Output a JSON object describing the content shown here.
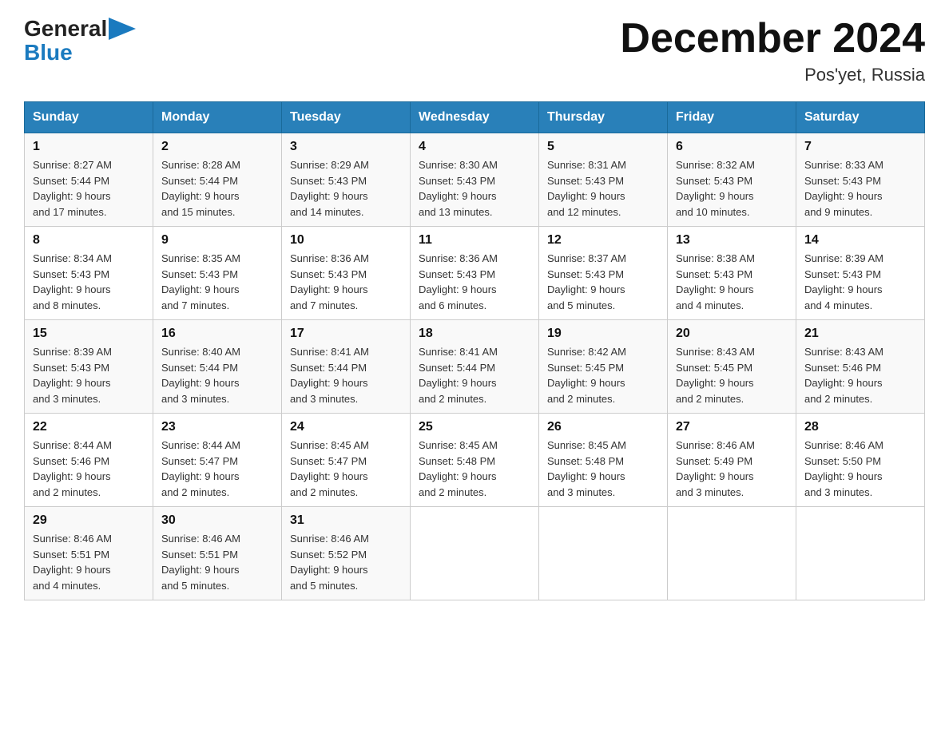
{
  "header": {
    "logo_text1": "General",
    "logo_text2": "Blue",
    "month": "December 2024",
    "location": "Pos'yet, Russia"
  },
  "days_of_week": [
    "Sunday",
    "Monday",
    "Tuesday",
    "Wednesday",
    "Thursday",
    "Friday",
    "Saturday"
  ],
  "weeks": [
    [
      {
        "day": "1",
        "sunrise": "8:27 AM",
        "sunset": "5:44 PM",
        "daylight": "9 hours and 17 minutes."
      },
      {
        "day": "2",
        "sunrise": "8:28 AM",
        "sunset": "5:44 PM",
        "daylight": "9 hours and 15 minutes."
      },
      {
        "day": "3",
        "sunrise": "8:29 AM",
        "sunset": "5:43 PM",
        "daylight": "9 hours and 14 minutes."
      },
      {
        "day": "4",
        "sunrise": "8:30 AM",
        "sunset": "5:43 PM",
        "daylight": "9 hours and 13 minutes."
      },
      {
        "day": "5",
        "sunrise": "8:31 AM",
        "sunset": "5:43 PM",
        "daylight": "9 hours and 12 minutes."
      },
      {
        "day": "6",
        "sunrise": "8:32 AM",
        "sunset": "5:43 PM",
        "daylight": "9 hours and 10 minutes."
      },
      {
        "day": "7",
        "sunrise": "8:33 AM",
        "sunset": "5:43 PM",
        "daylight": "9 hours and 9 minutes."
      }
    ],
    [
      {
        "day": "8",
        "sunrise": "8:34 AM",
        "sunset": "5:43 PM",
        "daylight": "9 hours and 8 minutes."
      },
      {
        "day": "9",
        "sunrise": "8:35 AM",
        "sunset": "5:43 PM",
        "daylight": "9 hours and 7 minutes."
      },
      {
        "day": "10",
        "sunrise": "8:36 AM",
        "sunset": "5:43 PM",
        "daylight": "9 hours and 7 minutes."
      },
      {
        "day": "11",
        "sunrise": "8:36 AM",
        "sunset": "5:43 PM",
        "daylight": "9 hours and 6 minutes."
      },
      {
        "day": "12",
        "sunrise": "8:37 AM",
        "sunset": "5:43 PM",
        "daylight": "9 hours and 5 minutes."
      },
      {
        "day": "13",
        "sunrise": "8:38 AM",
        "sunset": "5:43 PM",
        "daylight": "9 hours and 4 minutes."
      },
      {
        "day": "14",
        "sunrise": "8:39 AM",
        "sunset": "5:43 PM",
        "daylight": "9 hours and 4 minutes."
      }
    ],
    [
      {
        "day": "15",
        "sunrise": "8:39 AM",
        "sunset": "5:43 PM",
        "daylight": "9 hours and 3 minutes."
      },
      {
        "day": "16",
        "sunrise": "8:40 AM",
        "sunset": "5:44 PM",
        "daylight": "9 hours and 3 minutes."
      },
      {
        "day": "17",
        "sunrise": "8:41 AM",
        "sunset": "5:44 PM",
        "daylight": "9 hours and 3 minutes."
      },
      {
        "day": "18",
        "sunrise": "8:41 AM",
        "sunset": "5:44 PM",
        "daylight": "9 hours and 2 minutes."
      },
      {
        "day": "19",
        "sunrise": "8:42 AM",
        "sunset": "5:45 PM",
        "daylight": "9 hours and 2 minutes."
      },
      {
        "day": "20",
        "sunrise": "8:43 AM",
        "sunset": "5:45 PM",
        "daylight": "9 hours and 2 minutes."
      },
      {
        "day": "21",
        "sunrise": "8:43 AM",
        "sunset": "5:46 PM",
        "daylight": "9 hours and 2 minutes."
      }
    ],
    [
      {
        "day": "22",
        "sunrise": "8:44 AM",
        "sunset": "5:46 PM",
        "daylight": "9 hours and 2 minutes."
      },
      {
        "day": "23",
        "sunrise": "8:44 AM",
        "sunset": "5:47 PM",
        "daylight": "9 hours and 2 minutes."
      },
      {
        "day": "24",
        "sunrise": "8:45 AM",
        "sunset": "5:47 PM",
        "daylight": "9 hours and 2 minutes."
      },
      {
        "day": "25",
        "sunrise": "8:45 AM",
        "sunset": "5:48 PM",
        "daylight": "9 hours and 2 minutes."
      },
      {
        "day": "26",
        "sunrise": "8:45 AM",
        "sunset": "5:48 PM",
        "daylight": "9 hours and 3 minutes."
      },
      {
        "day": "27",
        "sunrise": "8:46 AM",
        "sunset": "5:49 PM",
        "daylight": "9 hours and 3 minutes."
      },
      {
        "day": "28",
        "sunrise": "8:46 AM",
        "sunset": "5:50 PM",
        "daylight": "9 hours and 3 minutes."
      }
    ],
    [
      {
        "day": "29",
        "sunrise": "8:46 AM",
        "sunset": "5:51 PM",
        "daylight": "9 hours and 4 minutes."
      },
      {
        "day": "30",
        "sunrise": "8:46 AM",
        "sunset": "5:51 PM",
        "daylight": "9 hours and 5 minutes."
      },
      {
        "day": "31",
        "sunrise": "8:46 AM",
        "sunset": "5:52 PM",
        "daylight": "9 hours and 5 minutes."
      },
      null,
      null,
      null,
      null
    ]
  ],
  "labels": {
    "sunrise": "Sunrise:",
    "sunset": "Sunset:",
    "daylight": "Daylight:"
  }
}
